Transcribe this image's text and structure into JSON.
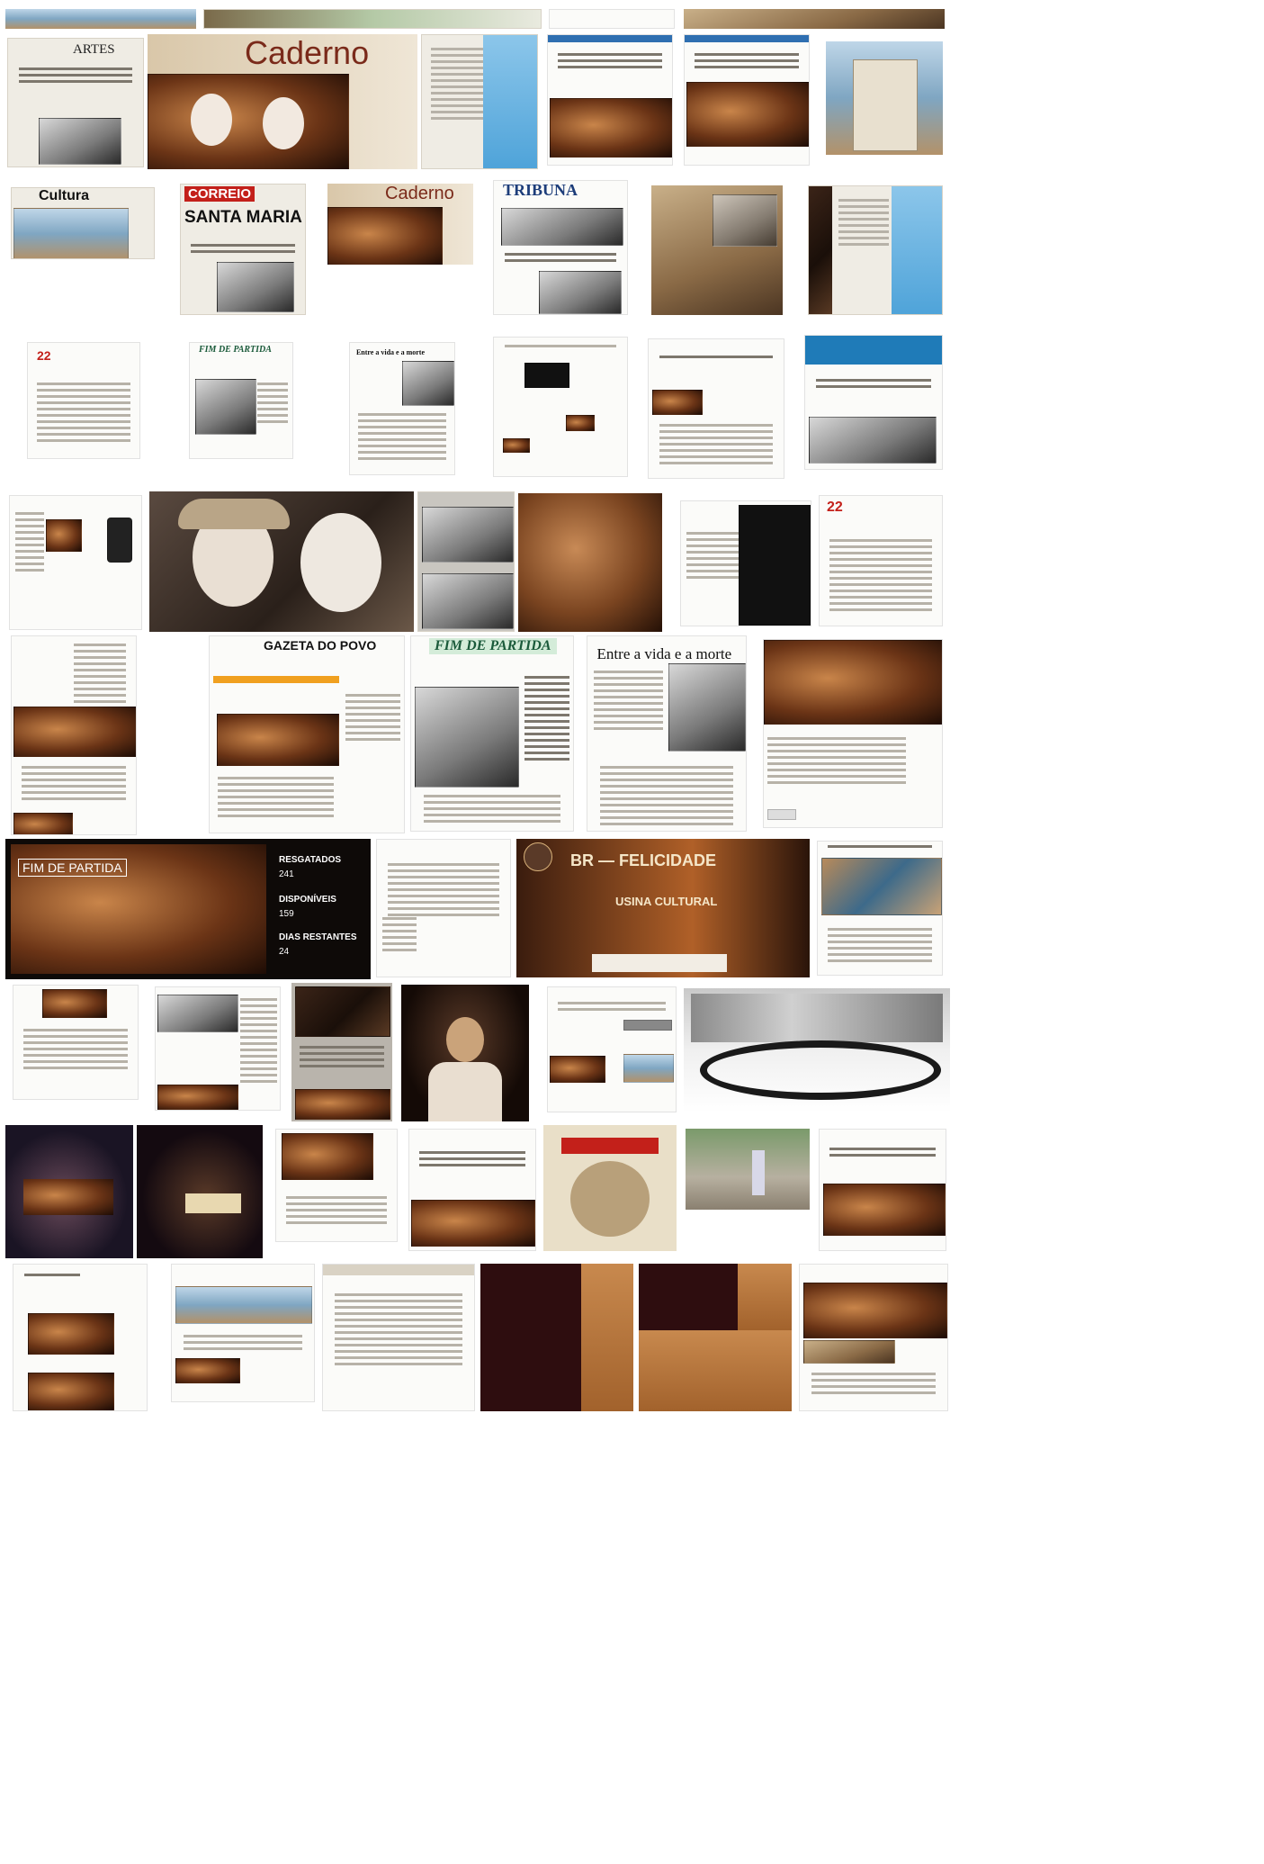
{
  "mastheads": {
    "artes": "ARTES",
    "caderno": "Caderno",
    "cultura": "Cultura",
    "correio": "CORREIO",
    "santa_maria": "SANTA MARIA",
    "tribuna": "TRIBUNA",
    "gazeta": "GAZETA DO POVO",
    "fim_de_partida": "FIM DE PARTIDA"
  },
  "campaign": {
    "title": "FIM DE PARTIDA",
    "resgatados_label": "RESGATADOS",
    "resgatados_value": "241",
    "disponiveis_label": "DISPONÍVEIS",
    "disponiveis_value": "159",
    "dias_label": "DIAS RESTANTES",
    "dias_value": "24"
  },
  "poster": {
    "title": "BR — FELICIDADE",
    "venue": "USINA CULTURAL"
  },
  "headlines": {
    "entre_vida": "Entre a vida e a morte",
    "fim_de_partida_header": "FIM DE PARTIDA",
    "page_22": "22"
  },
  "colors": {
    "background": "#ffffff",
    "newsprint": "#efece4",
    "maroon": "#2e0d0f",
    "web_blue": "#2f6fb1"
  }
}
